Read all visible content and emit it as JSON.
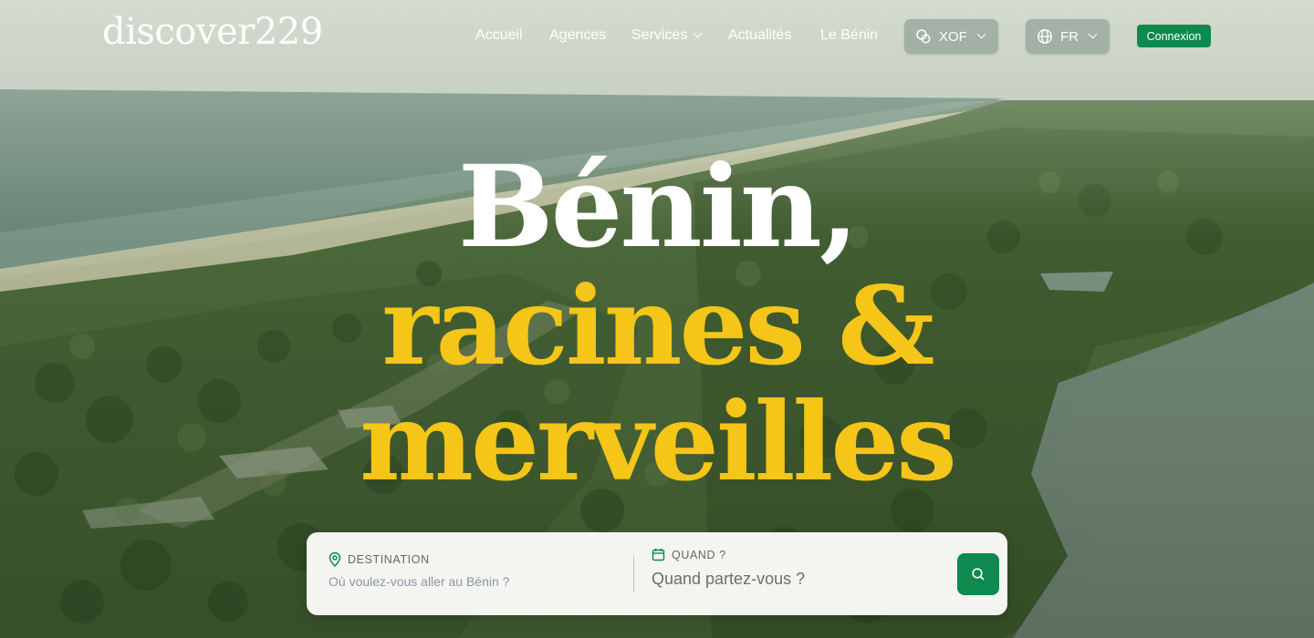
{
  "brand": {
    "logo_text": "discover229"
  },
  "nav": {
    "links": [
      {
        "label": "Accueil"
      },
      {
        "label": "Agences"
      },
      {
        "label": "Services",
        "has_dropdown": true
      },
      {
        "label": "Actualités"
      },
      {
        "label": "Le Bénin"
      }
    ],
    "currency": {
      "selected": "XOF",
      "icon": "coins-icon"
    },
    "language": {
      "selected": "FR",
      "icon": "globe-icon"
    },
    "login_label": "Connexion"
  },
  "hero": {
    "line1": "Bénin,",
    "line2": "racines &",
    "line3": "merveilles"
  },
  "search": {
    "destination_label": "DESTINATION",
    "destination_placeholder": "Où voulez-vous aller au Bénin ?",
    "when_label": "QUAND ?",
    "when_value": "Quand partez-vous ?",
    "search_icon": "search-icon"
  },
  "colors": {
    "accent_green": "#0e8a4f",
    "headline_yellow": "#f5c518",
    "headline_white": "#ffffff"
  }
}
